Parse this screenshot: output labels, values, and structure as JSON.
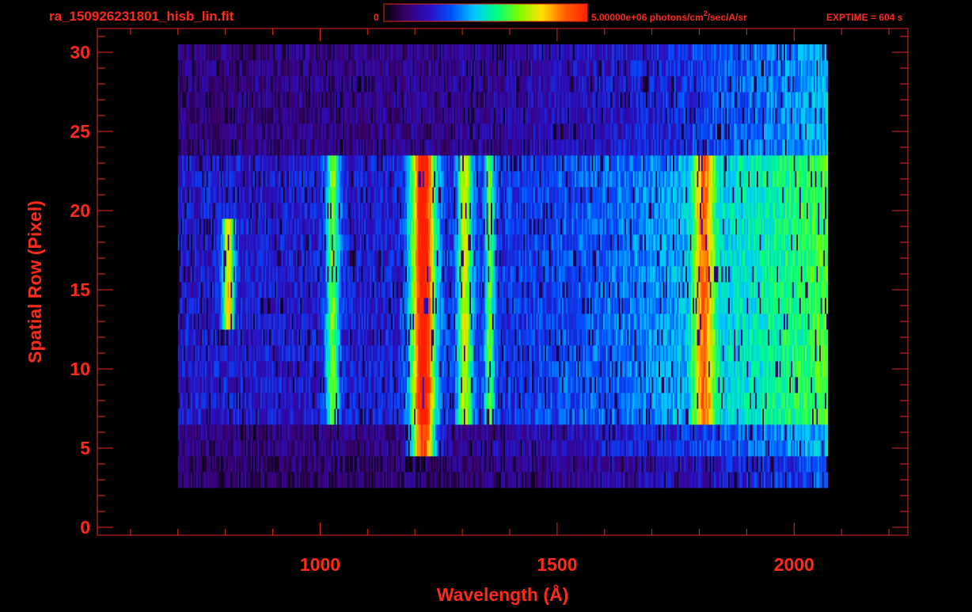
{
  "header": {
    "filename": "ra_150926231801_hisb_lin.fit",
    "colorbar_min_label": "0",
    "colorbar_max_value": "5.00000e+06 photons/cm",
    "colorbar_max_exp": "2",
    "colorbar_max_unit": "/sec/A/sr",
    "exptime_label": "EXPTIME = 604 s"
  },
  "colors": {
    "text": "#ff2a1a",
    "axis": "#e8281c",
    "background": "#000000",
    "colormap": [
      "#000000",
      "#3a0070",
      "#2a10c0",
      "#0050ff",
      "#00c8ff",
      "#00ff80",
      "#80ff00",
      "#ffe000",
      "#ff6000",
      "#ff2000"
    ]
  },
  "chart_data": {
    "type": "heatmap",
    "xlabel": "Wavelength (Å)",
    "ylabel": "Spatial Row (Pixel)",
    "xlim": [
      530,
      2240
    ],
    "ylim": [
      -0.5,
      31.5
    ],
    "x_ticks": [
      1000,
      1500,
      2000
    ],
    "x_tick_labels": [
      "1000",
      "1500",
      "2000"
    ],
    "y_ticks": [
      0,
      5,
      10,
      15,
      20,
      25,
      30
    ],
    "y_tick_labels": [
      "0",
      "5",
      "10",
      "15",
      "20",
      "25",
      "30"
    ],
    "color_range": [
      0,
      5000000
    ],
    "color_unit": "photons/cm^2/sec/A/sr",
    "detector_extent": {
      "x_range": [
        700,
        2070
      ],
      "rows": [
        3,
        30
      ]
    },
    "slit_region": {
      "rows": [
        7,
        23
      ]
    },
    "emission_features": [
      {
        "x": 805,
        "rows": [
          13,
          19
        ],
        "level": 0.55,
        "width": 12
      },
      {
        "x": 1025,
        "rows": [
          7,
          23
        ],
        "level": 0.42,
        "width": 14
      },
      {
        "x": 1216,
        "rows": [
          5,
          23
        ],
        "level": 0.8,
        "width": 26
      },
      {
        "x": 1304,
        "rows": [
          7,
          23
        ],
        "level": 0.45,
        "width": 16
      },
      {
        "x": 1356,
        "rows": [
          7,
          23
        ],
        "level": 0.36,
        "width": 10
      },
      {
        "x": 1808,
        "rows": [
          7,
          23
        ],
        "level": 0.46,
        "width": 22
      }
    ]
  }
}
